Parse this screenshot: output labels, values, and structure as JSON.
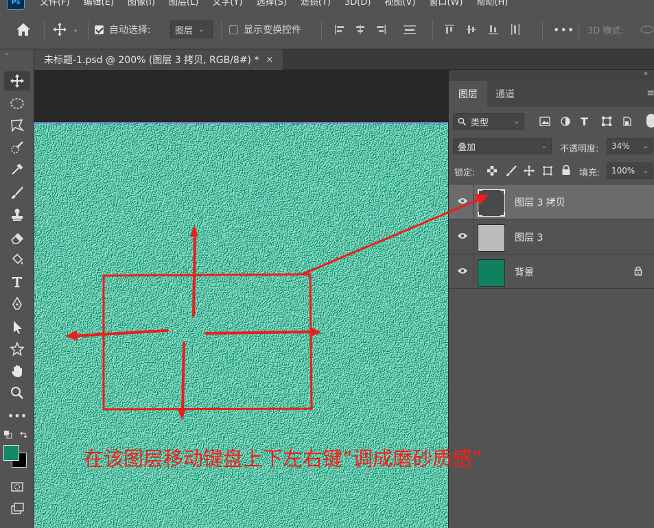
{
  "menu": {
    "logo": "Ps",
    "items": [
      "文件(F)",
      "编辑(E)",
      "图像(I)",
      "图层(L)",
      "文字(Y)",
      "选择(S)",
      "滤镜(T)",
      "3D(D)",
      "视图(V)",
      "窗口(W)",
      "帮助(H)"
    ]
  },
  "options": {
    "auto_select_label": "自动选择:",
    "auto_select_value": "图层",
    "show_transform_label": "显示变换控件",
    "more": "•••",
    "mode_3d_label": "3D 模式:"
  },
  "document": {
    "tab_title": "未标题-1.psd @ 200% (图层 3 拷贝, RGB/8#) *",
    "close": "×"
  },
  "panel": {
    "tabs": [
      "图层",
      "通道"
    ],
    "filter_label": "类型",
    "blend_mode": "叠加",
    "opacity_label": "不透明度:",
    "opacity_value": "34%",
    "lock_label": "锁定:",
    "fill_label": "填充:",
    "fill_value": "100%",
    "layers": [
      {
        "name": "图层 3 拷贝",
        "selected": true,
        "thumb_color": "#4a4a4a"
      },
      {
        "name": "图层 3",
        "selected": false,
        "thumb_color": "#b8b8b8"
      },
      {
        "name": "背景",
        "selected": false,
        "thumb_color": "#0f7f5e",
        "locked": true
      }
    ]
  },
  "colors": {
    "canvas_green": "#1f8a66",
    "foreground": "#12876a",
    "background": "#000000",
    "annotation": "#ff1a1a"
  },
  "annotation": {
    "text": "在该图层移动键盘上下左右键“调成磨砂质感”"
  }
}
